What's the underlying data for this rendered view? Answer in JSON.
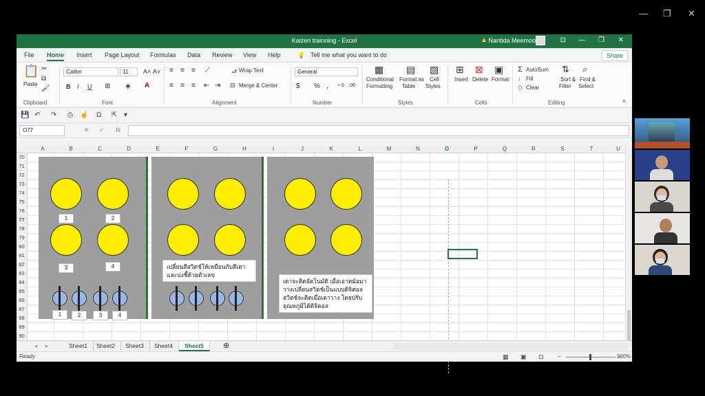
{
  "window": {
    "title": "Kaizen trainning  -  Excel",
    "user": "Nantida Meemoo"
  },
  "menu": {
    "tabs": [
      "File",
      "Home",
      "Insert",
      "Page Layout",
      "Formulas",
      "Data",
      "Review",
      "View",
      "Help"
    ],
    "tell_me": "Tell me what you want to do",
    "share": "Share"
  },
  "ribbon": {
    "clipboard": {
      "paste": "Paste",
      "label": "Clipboard"
    },
    "font": {
      "name": "Calibri",
      "size": "11",
      "bold": "B",
      "italic": "I",
      "underline": "U",
      "label": "Font"
    },
    "alignment": {
      "wrap_text": "Wrap Text",
      "merge_center": "Merge & Center",
      "label": "Alignment"
    },
    "number": {
      "format": "General",
      "currency": "$",
      "percent": "%",
      "comma": ",",
      "label": "Number"
    },
    "styles": {
      "conditional": "Conditional",
      "conditional2": "Formatting",
      "format_as": "Format as",
      "format_as2": "Table",
      "cell": "Cell",
      "cell2": "Styles",
      "label": "Styles"
    },
    "cells": {
      "insert": "Insert",
      "delete": "Delete",
      "format": "Format",
      "label": "Cells"
    },
    "editing": {
      "autosum": "AutoSum",
      "fill": "Fill",
      "clear": "Clear",
      "sort": "Sort &",
      "sort2": "Filter",
      "find": "Find &",
      "find2": "Select",
      "label": "Editing"
    }
  },
  "formula_bar": {
    "name_box": "O77",
    "fx": "fx"
  },
  "columns": [
    "A",
    "B",
    "C",
    "D",
    "E",
    "F",
    "G",
    "H",
    "I",
    "J",
    "K",
    "L",
    "M",
    "N",
    "O",
    "P",
    "Q",
    "R",
    "S",
    "T",
    "U"
  ],
  "rows": [
    "70",
    "71",
    "72",
    "73",
    "74",
    "75",
    "76",
    "77",
    "78",
    "79",
    "80",
    "81",
    "82",
    "83",
    "84",
    "85",
    "86",
    "87",
    "88",
    "89",
    "90"
  ],
  "panel1": {
    "labels_top": [
      "1",
      "2"
    ],
    "labels_mid": [
      "3",
      "4"
    ],
    "labels_switch": [
      "1",
      "2",
      "3",
      "4"
    ]
  },
  "notes": {
    "panel2": "เปลี่ยนสีสวิตช์ให้เหมือนกับสีเตา และบ่งชี้ด้วยตัวเลข",
    "panel3": "เตาจะติดอัตโนมัติ เมื่อเอาหม้อมาวางเปลี่ยนสวิตช์เป็นแบบดิจิตอลสวิตช์จะติดเมื่อเตาวาง โดยปรับอุณหภูมิได้ดิจิตอล"
  },
  "sheets": [
    "Sheet1",
    "Sheet2",
    "Sheet3",
    "Sheet4",
    "Sheet5"
  ],
  "active_sheet": "Sheet5",
  "status": {
    "ready": "Ready",
    "zoom": "100%"
  },
  "colors": {
    "excel_green": "#217346",
    "burner_yellow": "#ffee00",
    "stove_gray": "#9e9e9e"
  }
}
